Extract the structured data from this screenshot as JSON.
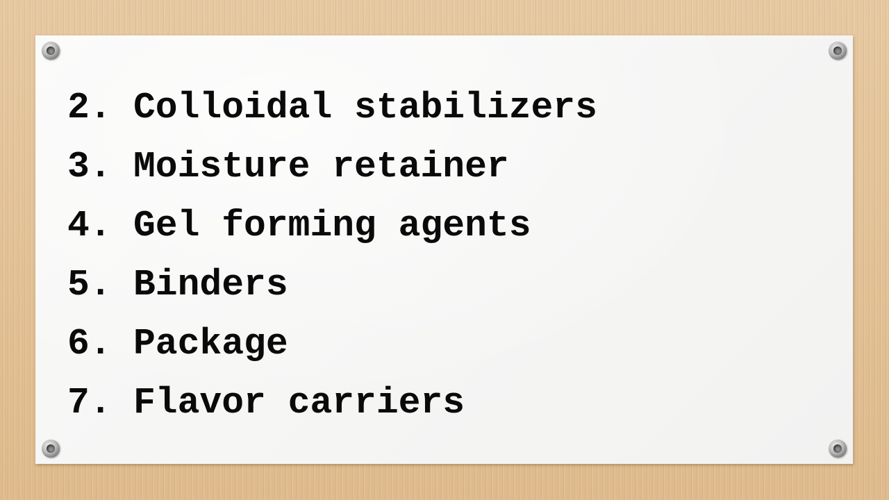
{
  "slide": {
    "items": [
      {
        "number": "2.",
        "text": "Colloidal stabilizers"
      },
      {
        "number": "3.",
        "text": "Moisture retainer"
      },
      {
        "number": "4.",
        "text": "Gel forming agents"
      },
      {
        "number": "5.",
        "text": "Binders"
      },
      {
        "number": "6.",
        "text": "Package"
      },
      {
        "number": "7.",
        "text": "Flavor carriers"
      }
    ]
  },
  "colors": {
    "background": "#e3c49b",
    "board": "#f7f7f6",
    "text": "#0a0a0a"
  }
}
